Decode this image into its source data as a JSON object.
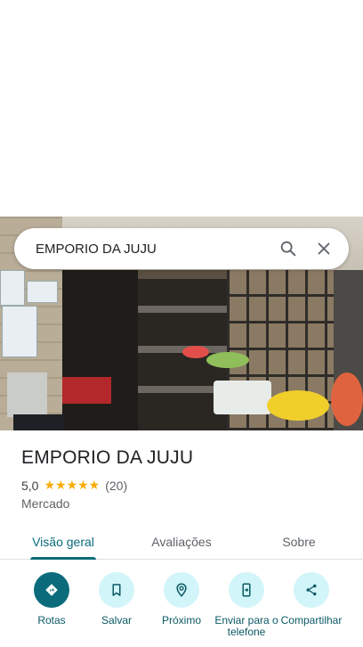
{
  "search": {
    "query": "EMPORIO DA JUJU"
  },
  "place": {
    "name": "EMPORIO DA JUJU",
    "rating": "5,0",
    "stars": "★★★★★",
    "review_count": "(20)",
    "category": "Mercado"
  },
  "tabs": [
    {
      "label": "Visão geral"
    },
    {
      "label": "Avaliações"
    },
    {
      "label": "Sobre"
    }
  ],
  "actions": [
    {
      "label": "Rotas",
      "icon": "directions-icon"
    },
    {
      "label": "Salvar",
      "icon": "bookmark-icon"
    },
    {
      "label": "Próximo",
      "icon": "nearby-icon"
    },
    {
      "label": "Enviar para o telefone",
      "icon": "send-to-phone-icon"
    },
    {
      "label": "Compartilhar",
      "icon": "share-icon"
    }
  ],
  "colors": {
    "accent": "#0b6b7a",
    "action_bg": "#d2f5f9",
    "star": "#f9ab00"
  }
}
